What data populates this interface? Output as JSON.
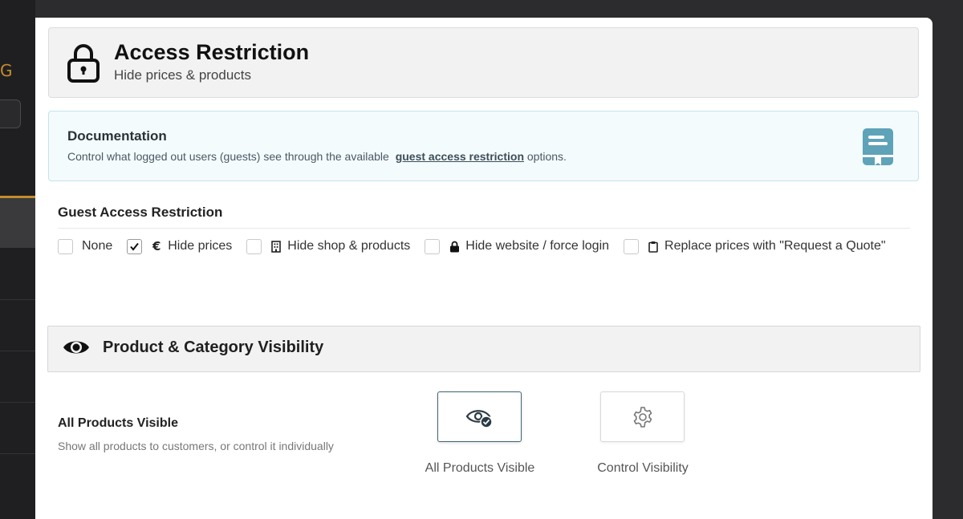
{
  "header": {
    "title": "Access Restriction",
    "subtitle": "Hide prices & products"
  },
  "documentation": {
    "title": "Documentation",
    "text_before": "Control what logged out users (guests) see through the available",
    "link": "guest access restriction",
    "text_after": " options."
  },
  "guest_access": {
    "label": "Guest Access Restriction",
    "options": [
      {
        "label": "None",
        "checked": false,
        "icon": null
      },
      {
        "label": "Hide prices",
        "checked": true,
        "icon": "euro-icon"
      },
      {
        "label": "Hide shop & products",
        "checked": false,
        "icon": "building-icon"
      },
      {
        "label": "Hide website / force login",
        "checked": false,
        "icon": "lock-icon"
      },
      {
        "label": "Replace prices with \"Request a Quote\"",
        "checked": false,
        "icon": "clipboard-icon"
      }
    ]
  },
  "visibility": {
    "title": "Product & Category Visibility",
    "setting_label": "All Products Visible",
    "setting_desc": "Show all products to customers, or control it individually",
    "choices": [
      {
        "label": "All Products Visible",
        "selected": true,
        "icon": "eye-check-icon"
      },
      {
        "label": "Control Visibility",
        "selected": false,
        "icon": "gear-icon"
      }
    ]
  },
  "colors": {
    "accent": "#c48b2c",
    "doc_icon": "#5fa3b8",
    "selected_border": "#3f6577"
  }
}
